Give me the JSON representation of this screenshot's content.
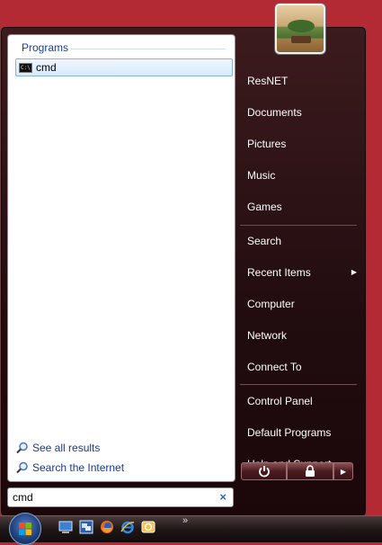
{
  "left_pane": {
    "programs_header": "Programs",
    "result_item": {
      "label": "cmd",
      "icon": "command-prompt-icon"
    },
    "see_all": "See all results",
    "search_internet": "Search the Internet"
  },
  "search": {
    "value": "cmd"
  },
  "right_pane": {
    "items": [
      "ResNET",
      "Documents",
      "Pictures",
      "Music",
      "Games",
      "Search",
      "Recent Items",
      "Computer",
      "Network",
      "Connect To",
      "Control Panel",
      "Default Programs",
      "Help and Support"
    ]
  },
  "power": {
    "power_icon": "power-icon",
    "lock_icon": "lock-icon",
    "more_icon": "arrow-right-icon"
  },
  "taskbar": {
    "quick_launch": [
      "show-desktop-icon",
      "switch-windows-icon",
      "firefox-icon",
      "internet-explorer-icon",
      "outlook-icon"
    ],
    "overflow": "»"
  },
  "colors": {
    "desktop": "#b32a34",
    "menu": "#2a1013",
    "link": "#1c3a82"
  }
}
